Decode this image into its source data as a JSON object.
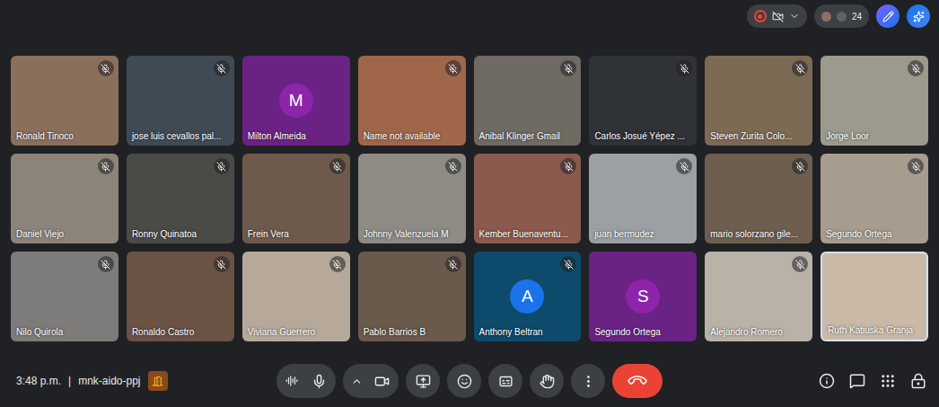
{
  "top_bar": {
    "participant_count": "24"
  },
  "tiles": [
    {
      "name": "Ronald Tinoco",
      "kind": "video",
      "muted": true,
      "speaking": false,
      "color": "#8a6f5c"
    },
    {
      "name": "jose luis cevallos pal...",
      "kind": "video",
      "muted": true,
      "speaking": false,
      "color": "#3f4a55"
    },
    {
      "name": "Milton Almeida",
      "kind": "avatar",
      "letter": "M",
      "muted": false,
      "speaking": false,
      "color": "#6a2384",
      "avatar_color": "#8e24aa"
    },
    {
      "name": "Name not available",
      "kind": "video",
      "muted": true,
      "speaking": false,
      "color": "#a0664a"
    },
    {
      "name": "Anibal Klinger Gmail",
      "kind": "video",
      "muted": true,
      "speaking": false,
      "color": "#6f6a62"
    },
    {
      "name": "Carlos Josué Yépez ...",
      "kind": "video",
      "muted": true,
      "speaking": false,
      "color": "#2f3236"
    },
    {
      "name": "Steven Zurita Colo...",
      "kind": "video",
      "muted": true,
      "speaking": false,
      "color": "#7d6a55"
    },
    {
      "name": "Jorge Loor",
      "kind": "video",
      "muted": true,
      "speaking": false,
      "color": "#9c9a8c"
    },
    {
      "name": "Daniel Viejo",
      "kind": "video",
      "muted": true,
      "speaking": false,
      "color": "#8c8478"
    },
    {
      "name": "Ronny Quinatoa",
      "kind": "video",
      "muted": true,
      "speaking": false,
      "color": "#4a4a46"
    },
    {
      "name": "Frein Vera",
      "kind": "video",
      "muted": true,
      "speaking": false,
      "color": "#6d5a4c"
    },
    {
      "name": "Johnny Valenzuela M",
      "kind": "video",
      "muted": true,
      "speaking": false,
      "color": "#8e8a84"
    },
    {
      "name": "Kember Buenaventu...",
      "kind": "video",
      "muted": true,
      "speaking": false,
      "color": "#8a5a4e"
    },
    {
      "name": "juan bermudez",
      "kind": "video",
      "muted": true,
      "speaking": false,
      "color": "#9aa0a3"
    },
    {
      "name": "mario solorzano gile...",
      "kind": "video",
      "muted": true,
      "speaking": false,
      "color": "#6e5e50"
    },
    {
      "name": "Segundo Ortega",
      "kind": "video",
      "muted": true,
      "speaking": false,
      "color": "#a89c8e"
    },
    {
      "name": "Nilo Quirola",
      "kind": "video",
      "muted": true,
      "speaking": false,
      "color": "#7d7c7a"
    },
    {
      "name": "Ronaldo Castro",
      "kind": "video",
      "muted": true,
      "speaking": false,
      "color": "#6a5245"
    },
    {
      "name": "Viviana Guerrero",
      "kind": "video",
      "muted": true,
      "speaking": false,
      "color": "#b7a99a"
    },
    {
      "name": "Pablo Barrios B",
      "kind": "video",
      "muted": true,
      "speaking": false,
      "color": "#6a5a4c"
    },
    {
      "name": "Anthony Beltran",
      "kind": "avatar",
      "letter": "A",
      "muted": true,
      "speaking": false,
      "color": "#0d4a6b",
      "avatar_color": "#1a73e8"
    },
    {
      "name": "Segundo Ortega",
      "kind": "avatar",
      "letter": "S",
      "muted": false,
      "speaking": false,
      "color": "#6a2384",
      "avatar_color": "#8e24aa"
    },
    {
      "name": "Alejandro Romero",
      "kind": "video",
      "muted": true,
      "speaking": false,
      "color": "#b9b2a6"
    },
    {
      "name": "Ruth Katiuska Granja",
      "kind": "video",
      "muted": false,
      "speaking": true,
      "color": "#c9b9a6"
    }
  ],
  "bottom_bar": {
    "time": "3:48 p.m.",
    "separator": "|",
    "meeting_code": "mnk-aido-ppj",
    "mic_on": true,
    "camera_on": true
  }
}
